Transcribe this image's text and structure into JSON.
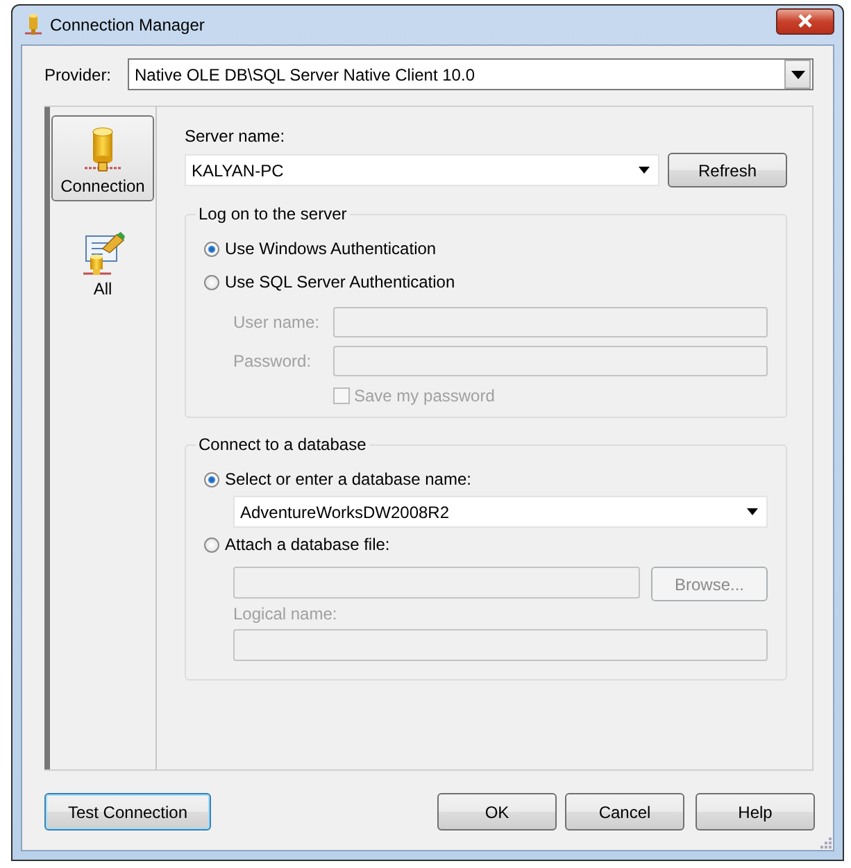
{
  "window": {
    "title": "Connection Manager"
  },
  "provider": {
    "label": "Provider:",
    "value": "Native OLE DB\\SQL Server Native Client 10.0"
  },
  "sidebar": {
    "items": [
      {
        "label": "Connection",
        "kind": "connection",
        "selected": true
      },
      {
        "label": "All",
        "kind": "all",
        "selected": false
      }
    ]
  },
  "server": {
    "label": "Server name:",
    "value": "KALYAN-PC",
    "refresh_button": "Refresh"
  },
  "logon_group": {
    "title": "Log on to the server",
    "options": [
      {
        "label": "Use Windows Authentication",
        "selected": true
      },
      {
        "label": "Use SQL Server Authentication",
        "selected": false
      }
    ],
    "fields": [
      {
        "label": "User name:",
        "disabled": true
      },
      {
        "label": "Password:",
        "disabled": true
      }
    ],
    "save_password": {
      "label": "Save my password",
      "checked": false,
      "disabled": true
    }
  },
  "database_group": {
    "title": "Connect to a database",
    "options": [
      {
        "label": "Select or enter a database name:",
        "selected": true
      },
      {
        "label": "Attach a database file:",
        "selected": false
      }
    ],
    "database_name": {
      "value": "AdventureWorksDW2008R2"
    },
    "file": {
      "disabled": true,
      "browse_button": "Browse..."
    },
    "logical_name": {
      "label": "Logical name:",
      "disabled": true
    }
  },
  "left_buttons": [
    {
      "label": "Test Connection",
      "focused": true
    }
  ],
  "right_buttons": [
    {
      "label": "OK",
      "focused": false
    },
    {
      "label": "Cancel",
      "focused": false
    },
    {
      "label": "Help",
      "focused": false
    }
  ]
}
